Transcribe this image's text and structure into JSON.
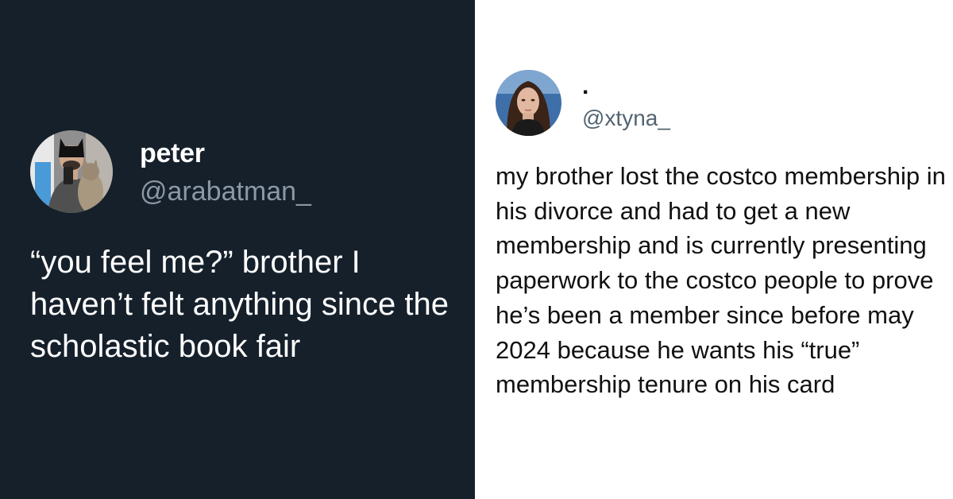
{
  "left_tweet": {
    "display_name": "peter",
    "handle": "@arabatman_",
    "avatar_icon": "profile-photo-batman-mask-with-cat",
    "text": "“you feel me?” brother I haven’t felt anything since the scholastic book fair",
    "background_color": "#15202b",
    "handle_color": "#8b98a5"
  },
  "right_tweet": {
    "display_name": ".",
    "handle": "@xtyna_",
    "avatar_icon": "profile-photo-woman-dark-hair",
    "text": "my brother lost the costco membership in his divorce and had to get a new membership and is currently presenting paperwork to the costco people to prove he’s been a member since before may 2024 because he wants his “true” membership tenure on his card",
    "background_color": "#ffffff",
    "handle_color": "#536471"
  }
}
